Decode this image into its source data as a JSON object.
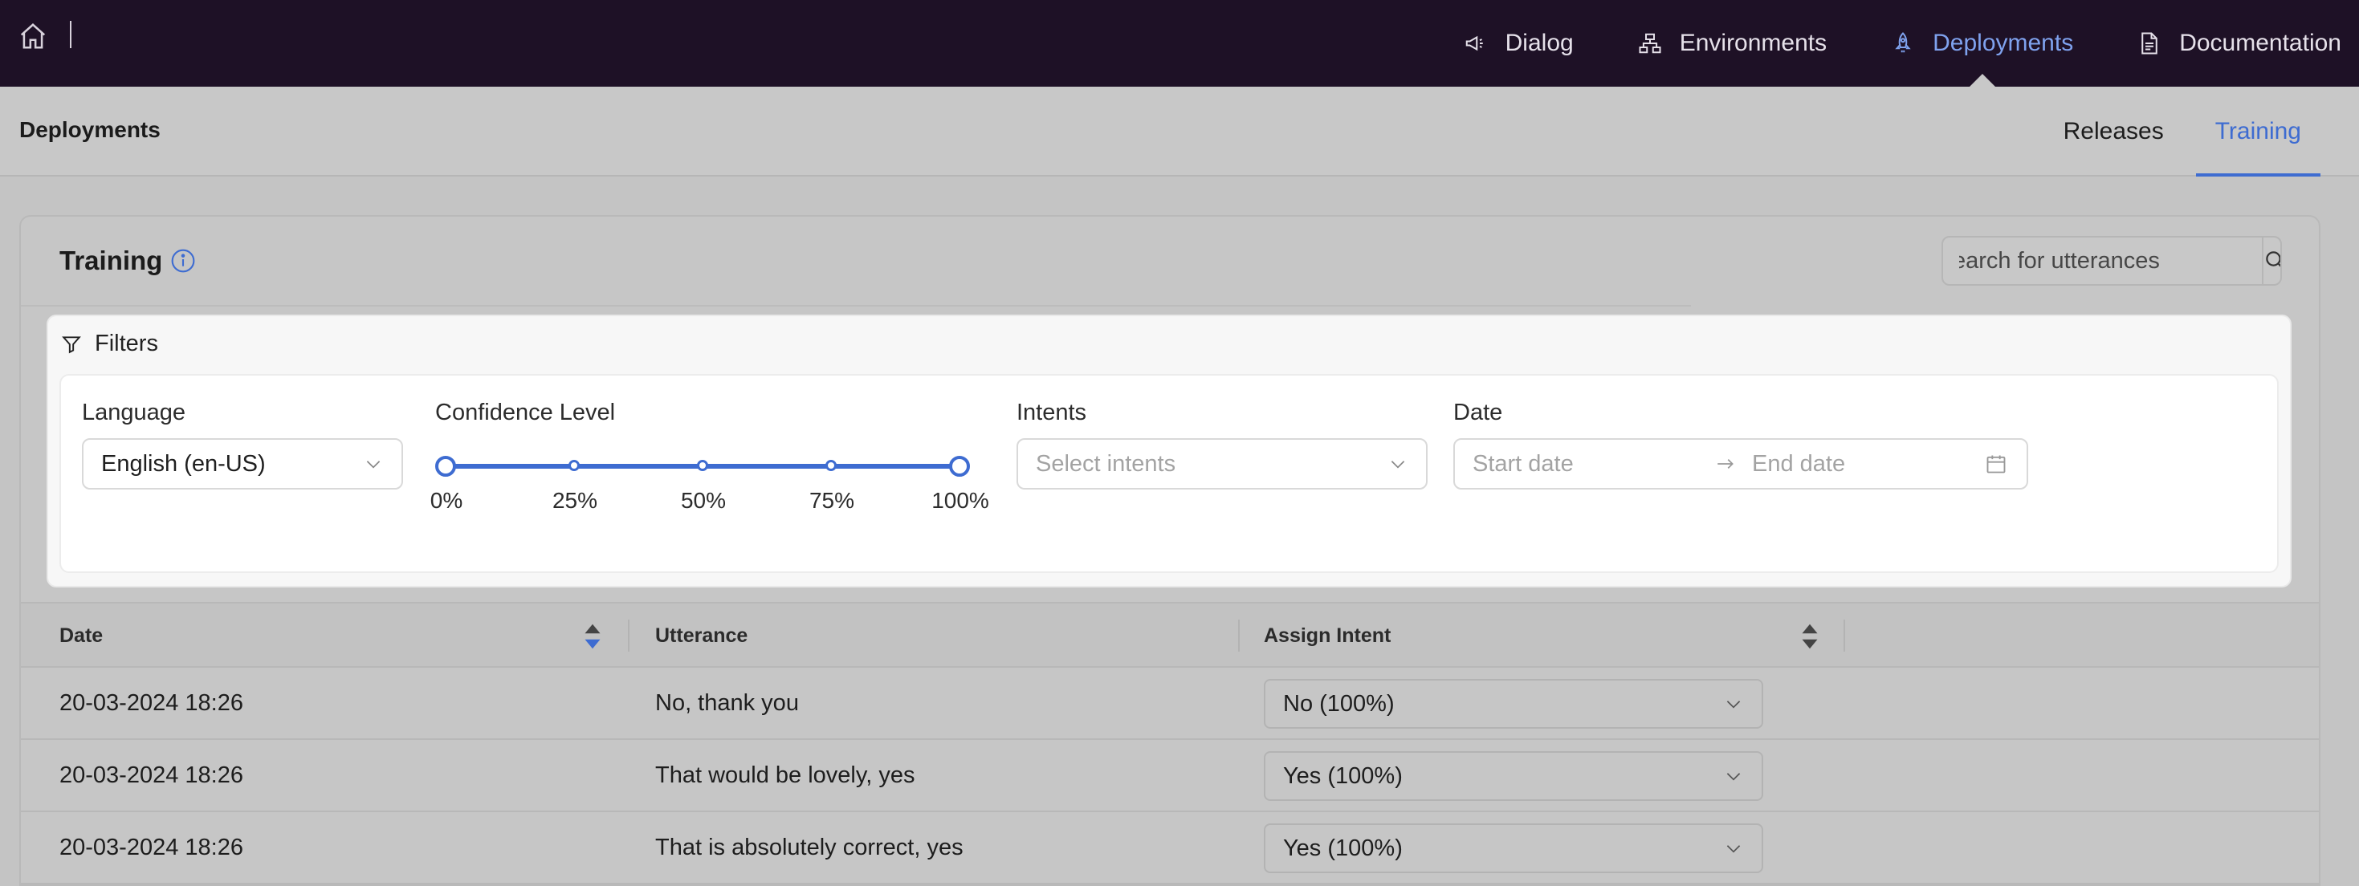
{
  "topnav": {
    "items": [
      {
        "label": "Dialog",
        "icon": "megaphone-icon"
      },
      {
        "label": "Environments",
        "icon": "sitemap-icon"
      },
      {
        "label": "Deployments",
        "icon": "rocket-icon",
        "active": true
      },
      {
        "label": "Documentation",
        "icon": "document-icon"
      }
    ]
  },
  "subheader": {
    "title": "Deployments",
    "tabs": [
      {
        "label": "Releases"
      },
      {
        "label": "Training",
        "active": true
      }
    ]
  },
  "card": {
    "title": "Training",
    "search_placeholder": "earch for utterances"
  },
  "filters": {
    "title": "Filters",
    "language": {
      "label": "Language",
      "value": "English (en-US)"
    },
    "confidence": {
      "label": "Confidence Level",
      "marks": [
        "0%",
        "25%",
        "50%",
        "75%",
        "100%"
      ],
      "range": [
        0,
        100
      ]
    },
    "intents": {
      "label": "Intents",
      "placeholder": "Select intents"
    },
    "date": {
      "label": "Date",
      "start_placeholder": "Start date",
      "end_placeholder": "End date"
    }
  },
  "table": {
    "headers": {
      "date": "Date",
      "utterance": "Utterance",
      "intent": "Assign Intent"
    },
    "rows": [
      {
        "date": "20-03-2024 18:26",
        "utterance": "No, thank you",
        "intent": "No (100%)"
      },
      {
        "date": "20-03-2024 18:26",
        "utterance": "That would be lovely, yes",
        "intent": "Yes (100%)"
      },
      {
        "date": "20-03-2024 18:26",
        "utterance": "That is absolutely correct, yes",
        "intent": "Yes (100%)"
      }
    ]
  },
  "colors": {
    "topbar": "#1e1126",
    "accent": "#3e6cd1",
    "nav_active": "#7fa2ee"
  }
}
